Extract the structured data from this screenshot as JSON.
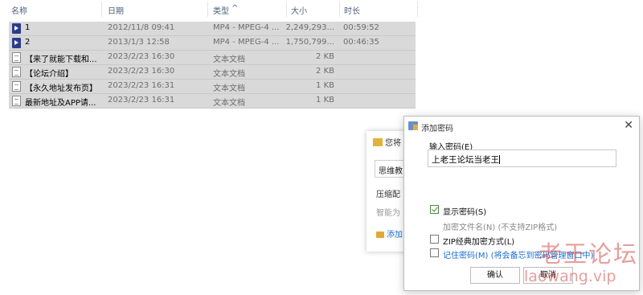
{
  "file_list": {
    "columns": {
      "name": "名称",
      "date": "日期",
      "type": "类型",
      "size": "大小",
      "duration": "时长"
    },
    "sorted_column": "type",
    "rows": [
      {
        "icon": "video-file-icon",
        "name": "1",
        "date": "2012/11/8 09:41",
        "type": "MP4 - MPEG-4 ...",
        "size": "2,249,293...",
        "duration": "00:59:52"
      },
      {
        "icon": "video-file-icon",
        "name": "2",
        "date": "2013/1/3 12:58",
        "type": "MP4 - MPEG-4 ...",
        "size": "1,750,799...",
        "duration": "00:46:35"
      },
      {
        "icon": "text-file-icon",
        "name": "【来了就能下载和...",
        "date": "2023/2/23 16:30",
        "type": "文本文档",
        "size": "2 KB",
        "duration": ""
      },
      {
        "icon": "text-file-icon",
        "name": "【论坛介绍】",
        "date": "2023/2/23 16:30",
        "type": "文本文档",
        "size": "2 KB",
        "duration": ""
      },
      {
        "icon": "text-file-icon",
        "name": "【永久地址发布页】",
        "date": "2023/2/23 16:31",
        "type": "文本文档",
        "size": "1 KB",
        "duration": ""
      },
      {
        "icon": "text-file-icon",
        "name": "最新地址及APP请...",
        "date": "2023/2/23 16:31",
        "type": "文本文档",
        "size": "1 KB",
        "duration": ""
      }
    ]
  },
  "background_dialog": {
    "title": "您将",
    "field_value": "思维教",
    "label_compress": "压缩配",
    "label_smart": "智能为",
    "link_add": "添加"
  },
  "password_dialog": {
    "title": "添加密码",
    "input_label": "输入密码(E)",
    "input_value": "上老王论坛当老王",
    "options": {
      "show_password": {
        "label": "显示密码(S)",
        "checked": true
      },
      "encrypt_filenames": {
        "label": "加密文件名(N) (不支持ZIP格式)",
        "checked": false,
        "disabled": true
      },
      "zip_legacy": {
        "label": "ZIP经典加密方式(L)",
        "checked": false
      },
      "remember": {
        "label": "记住密码(M) (将会备忘到密码管理窗口中)",
        "checked": false
      }
    },
    "ok_label": "确认",
    "cancel_label": "取消"
  },
  "watermark": {
    "chinese": "老王论坛",
    "url": "laowang.vip"
  },
  "colors": {
    "selection_row": "#d9d9d9",
    "link_blue": "#1a6fd0",
    "watermark_red": "#c82828"
  }
}
